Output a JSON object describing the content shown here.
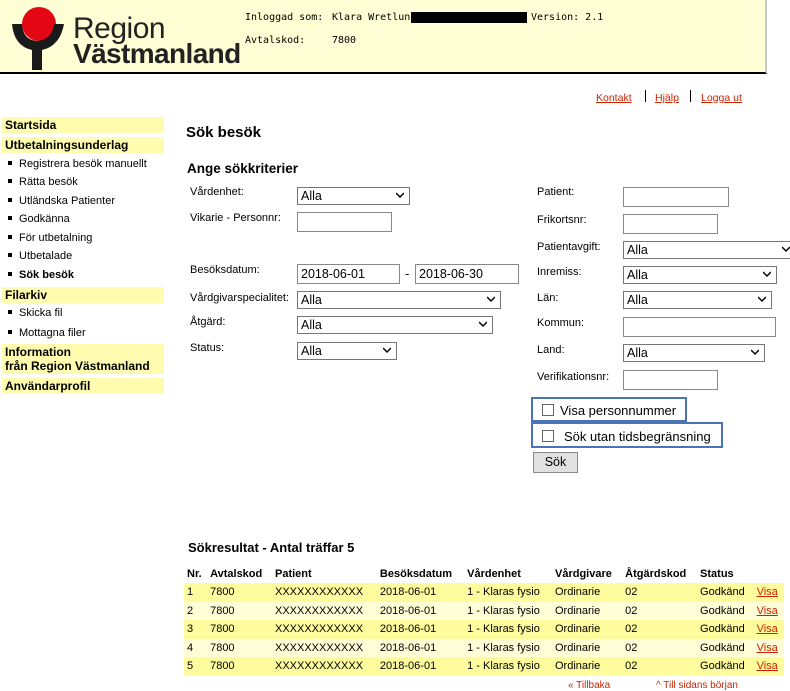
{
  "header": {
    "logo": {
      "line1": "Region",
      "line2": "Västmanland"
    },
    "logged_in_label": "Inloggad som:",
    "user_name": "Klara Wretlund",
    "version": "Version: 2.1",
    "agreement_label": "Avtalskod:",
    "agreement_code": "7800"
  },
  "toplinks": {
    "contact": "Kontakt",
    "help": "Hjälp",
    "logout": "Logga ut"
  },
  "nav": {
    "start": "Startsida",
    "payment_basis": "Utbetalningsunderlag",
    "items": [
      "Registrera besök manuellt",
      "Rätta besök",
      "Utländska Patienter",
      "Godkänna",
      "För utbetalning",
      "Utbetalade",
      "Sök besök"
    ],
    "file_archive": "Filarkiv",
    "file_items": [
      "Skicka fil",
      "Mottagna filer"
    ],
    "info_line1": "Information",
    "info_line2": "från Region Västmanland",
    "profile": "Användarprofil"
  },
  "main": {
    "title": "Sök besök",
    "criteria_title": "Ange sökkriterier",
    "left_fields": {
      "unit_label": "Vårdenhet:",
      "unit_value": "Alla",
      "substitute_label": "Vikarie - Personnr:",
      "visit_date_label": "Besöksdatum:",
      "date_from": "2018-06-01",
      "date_sep": "-",
      "date_to": "2018-06-30",
      "specialty_label": "Vårdgivarspecialitet:",
      "specialty_value": "Alla",
      "action_label": "Åtgärd:",
      "action_value": "Alla",
      "status_label": "Status:",
      "status_value": "Alla"
    },
    "right_fields": {
      "patient_label": "Patient:",
      "free_card_label": "Frikortsnr:",
      "patient_fee_label": "Patientavgift:",
      "patient_fee_value": "Alla",
      "referral_label": "Inremiss:",
      "referral_value": "Alla",
      "county_label": "Län:",
      "county_value": "Alla",
      "municipality_label": "Kommun:",
      "country_label": "Land:",
      "country_value": "Alla",
      "verification_label": "Verifikationsnr:"
    },
    "checkbox_show_pnr": "Visa personnummer",
    "checkbox_no_time_limit": "Sök utan tidsbegränsning",
    "search_button": "Sök"
  },
  "results": {
    "title": "Sökresultat - Antal träffar 5",
    "columns": [
      "Nr.",
      "Avtalskod",
      "Patient",
      "Besöksdatum",
      "Vårdenhet",
      "Vårdgivare",
      "Åtgärdskod",
      "Status",
      ""
    ],
    "rows": [
      [
        "1",
        "7800",
        "XXXXXXXXXXXX",
        "2018-06-01",
        "1 - Klaras fysio",
        "Ordinarie",
        "02",
        "Godkänd",
        "Visa"
      ],
      [
        "2",
        "7800",
        "XXXXXXXXXXXX",
        "2018-06-01",
        "1 - Klaras fysio",
        "Ordinarie",
        "02",
        "Godkänd",
        "Visa"
      ],
      [
        "3",
        "7800",
        "XXXXXXXXXXXX",
        "2018-06-01",
        "1 - Klaras fysio",
        "Ordinarie",
        "02",
        "Godkänd",
        "Visa"
      ],
      [
        "4",
        "7800",
        "XXXXXXXXXXXX",
        "2018-06-01",
        "1 - Klaras fysio",
        "Ordinarie",
        "02",
        "Godkänd",
        "Visa"
      ],
      [
        "5",
        "7800",
        "XXXXXXXXXXXX",
        "2018-06-01",
        "1 - Klaras fysio",
        "Ordinarie",
        "02",
        "Godkänd",
        "Visa"
      ]
    ]
  },
  "footer_links": {
    "back": "« Tillbaka",
    "top": "^ Till sidans början"
  },
  "colors": {
    "header_bg": "#fffed4",
    "nav_bg": "#fffcb0",
    "link": "#cc2200",
    "highlight_border": "#4a74b7",
    "logo_red": "#e30613"
  }
}
